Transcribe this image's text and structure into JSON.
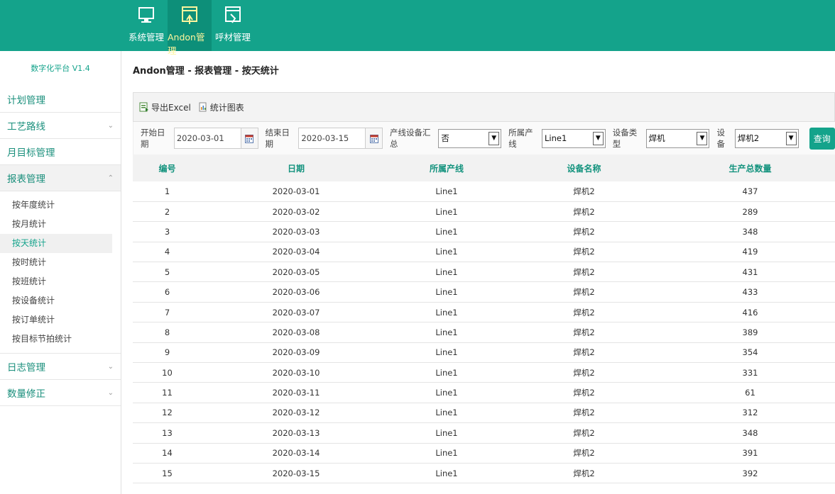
{
  "topnav": [
    {
      "label": "系统管理",
      "icon": "monitor-icon",
      "active": false
    },
    {
      "label": "Andon管理",
      "icon": "andon-icon",
      "active": true
    },
    {
      "label": "呼材管理",
      "icon": "material-call-icon",
      "active": false
    }
  ],
  "brand": "数字化平台 V1.4",
  "sidebar": {
    "groups": [
      {
        "label": "计划管理"
      },
      {
        "label": "工艺路线"
      },
      {
        "label": "月目标管理"
      },
      {
        "label": "报表管理"
      },
      {
        "label": "日志管理"
      },
      {
        "label": "数量修正"
      }
    ],
    "report_items": [
      "按年度统计",
      "按月统计",
      "按天统计",
      "按时统计",
      "按班统计",
      "按设备统计",
      "按订单统计",
      "按目标节拍统计"
    ]
  },
  "breadcrumb": "Andon管理 - 报表管理 - 按天统计",
  "toolbar": {
    "export_label": "导出Excel",
    "chart_label": "统计图表"
  },
  "filters": {
    "start_label": "开始日期",
    "start_value": "2020-03-01",
    "end_label": "结束日期",
    "end_value": "2020-03-15",
    "summary_label": "产线设备汇总",
    "summary_value": "否",
    "line_label": "所属产线",
    "line_value": "Line1",
    "type_label": "设备类型",
    "type_value": "焊机",
    "device_label": "设备",
    "device_value": "焊机2",
    "query_label": "查询"
  },
  "table": {
    "headers": [
      "编号",
      "日期",
      "所属产线",
      "设备名称",
      "生产总数量"
    ],
    "rows": [
      [
        "1",
        "2020-03-01",
        "Line1",
        "焊机2",
        "437"
      ],
      [
        "2",
        "2020-03-02",
        "Line1",
        "焊机2",
        "289"
      ],
      [
        "3",
        "2020-03-03",
        "Line1",
        "焊机2",
        "348"
      ],
      [
        "4",
        "2020-03-04",
        "Line1",
        "焊机2",
        "419"
      ],
      [
        "5",
        "2020-03-05",
        "Line1",
        "焊机2",
        "431"
      ],
      [
        "6",
        "2020-03-06",
        "Line1",
        "焊机2",
        "433"
      ],
      [
        "7",
        "2020-03-07",
        "Line1",
        "焊机2",
        "416"
      ],
      [
        "8",
        "2020-03-08",
        "Line1",
        "焊机2",
        "389"
      ],
      [
        "9",
        "2020-03-09",
        "Line1",
        "焊机2",
        "354"
      ],
      [
        "10",
        "2020-03-10",
        "Line1",
        "焊机2",
        "331"
      ],
      [
        "11",
        "2020-03-11",
        "Line1",
        "焊机2",
        "61"
      ],
      [
        "12",
        "2020-03-12",
        "Line1",
        "焊机2",
        "312"
      ],
      [
        "13",
        "2020-03-13",
        "Line1",
        "焊机2",
        "348"
      ],
      [
        "14",
        "2020-03-14",
        "Line1",
        "焊机2",
        "391"
      ],
      [
        "15",
        "2020-03-15",
        "Line1",
        "焊机2",
        "392"
      ]
    ]
  },
  "colors": {
    "primary": "#14a38b",
    "active_nav_text": "#fff59d"
  }
}
